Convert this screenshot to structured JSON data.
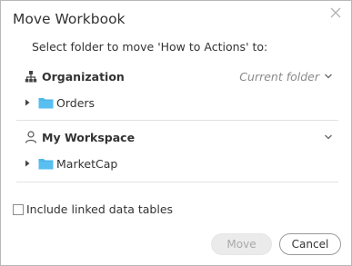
{
  "dialog": {
    "title": "Move Workbook",
    "instruction": "Select folder to move 'How to Actions' to:"
  },
  "sections": [
    {
      "label": "Organization",
      "icon": "hierarchy-icon",
      "status": "Current folder",
      "folders": [
        {
          "name": "Orders",
          "expanded": false
        }
      ]
    },
    {
      "label": "My Workspace",
      "icon": "user-icon",
      "status": "",
      "folders": [
        {
          "name": "MarketCap",
          "expanded": false
        }
      ]
    }
  ],
  "options": {
    "include_linked_label": "Include linked data tables",
    "include_linked_checked": false
  },
  "buttons": {
    "move_label": "Move",
    "move_enabled": false,
    "cancel_label": "Cancel"
  },
  "colors": {
    "folder": "#4fb6e8",
    "disabled_button_bg": "#ebebeb",
    "muted_text": "#8a8a8a"
  }
}
